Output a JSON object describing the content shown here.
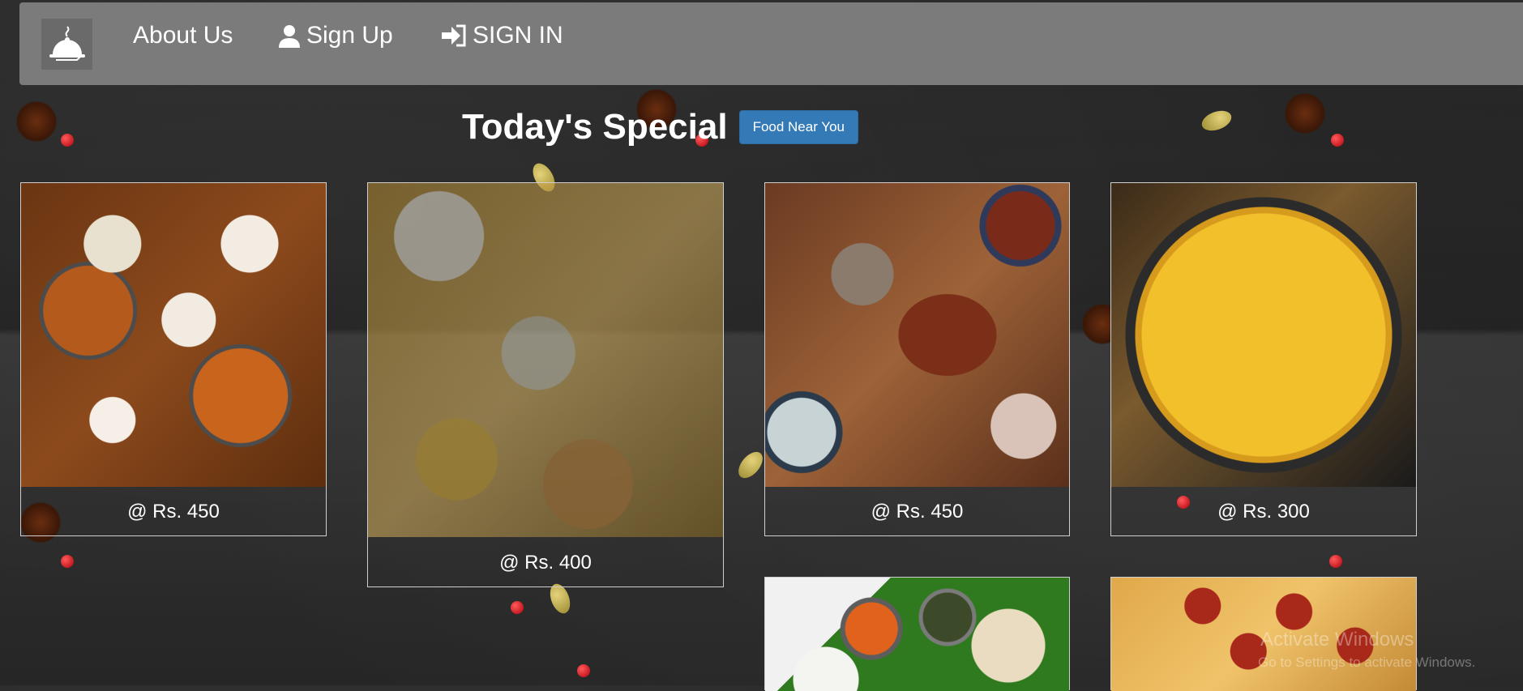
{
  "nav": {
    "about": "About Us",
    "signup": "Sign Up",
    "signin": "SIGN IN"
  },
  "heading": {
    "title": "Today's Special",
    "button": "Food Near You"
  },
  "cards": [
    {
      "price": "@ Rs. 450"
    },
    {
      "price": "@ Rs. 400"
    },
    {
      "price": "@ Rs. 450"
    },
    {
      "price": "@ Rs. 300"
    },
    {
      "price": ""
    },
    {
      "price": ""
    }
  ],
  "watermark": {
    "line1": "Activate Windows",
    "line2": "Go to Settings to activate Windows."
  },
  "icons": [
    "cloche-logo-icon",
    "user-icon",
    "sign-in-icon"
  ]
}
